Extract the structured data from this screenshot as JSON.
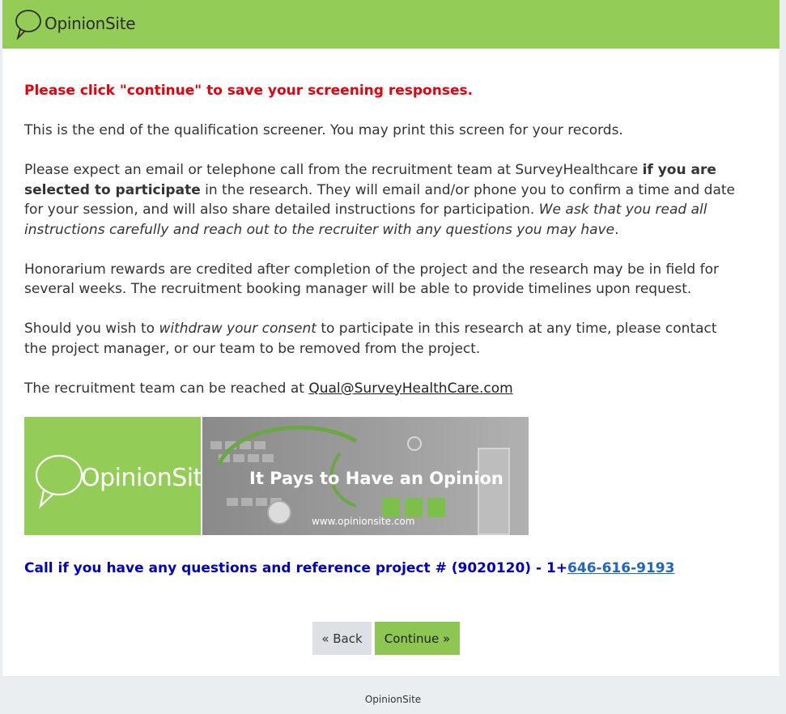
{
  "header": {
    "logo_text": "OpinionSite"
  },
  "content": {
    "notice": "Please click \"continue\" to save your screening responses.",
    "para1": "This is the end of the qualification screener. You may print this screen for your records.",
    "para2_a": "Please expect an email or telephone call from the recruitment team at SurveyHealthcare ",
    "para2_b": "if you are selected to participate",
    "para2_c": " in the research. They will email and/or phone you to confirm a time and date for your session, and will also share detailed instructions for participation. ",
    "para2_d": "We ask that you read all instructions carefully and reach out to the recruiter with any questions you may have",
    "para2_e": ".",
    "para3": "Honorarium rewards are credited after completion of the project and the research may be in field for several weeks. The recruitment booking manager will be able to provide timelines upon request.",
    "para4_a": "Should you wish to ",
    "para4_b": "withdraw your consent",
    "para4_c": " to participate in this research at any time, please contact the project manager, or our team to be removed from the project.",
    "para5_a": "The recruitment team can be reached at ",
    "email": "Qual@SurveyHealthCare.com"
  },
  "banner": {
    "logo_text": "OpinionSite",
    "tagline": "It Pays to Have an Opinion",
    "url": "www.opinionsite.com"
  },
  "call": {
    "text": "Call if you have any questions and reference project # (9020120) - 1+",
    "phone": "646-616-9193"
  },
  "buttons": {
    "back": "« Back",
    "continue": "Continue »"
  },
  "footer": {
    "text": "OpinionSite"
  },
  "colors": {
    "brand_green": "#93cd58",
    "notice_red": "#e8000b",
    "call_blue": "#0000c8"
  }
}
